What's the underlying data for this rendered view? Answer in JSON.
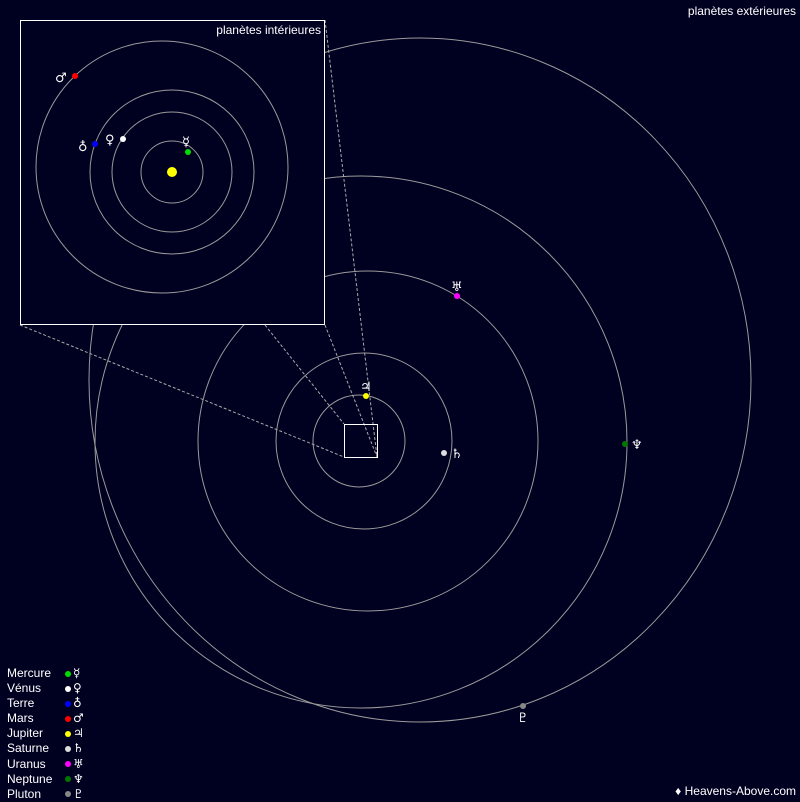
{
  "titles": {
    "outer": "planètes extérieures",
    "inner": "planètes intérieures"
  },
  "credit": "♦ Heavens-Above.com",
  "colors": {
    "background": "#000020",
    "orbit": "#9a9a9a",
    "sun": "#ffff00",
    "frame": "#ffffff"
  },
  "planets": [
    {
      "name": "Mercure",
      "symbol": "☿",
      "color": "#00dd00",
      "group": "inner"
    },
    {
      "name": "Vénus",
      "symbol": "♀",
      "color": "#ffffff",
      "group": "inner"
    },
    {
      "name": "Terre",
      "symbol": "♁",
      "color": "#0000ff",
      "group": "inner"
    },
    {
      "name": "Mars",
      "symbol": "♂",
      "color": "#ff0000",
      "group": "inner"
    },
    {
      "name": "Jupiter",
      "symbol": "♃",
      "color": "#ffff00",
      "group": "outer"
    },
    {
      "name": "Saturne",
      "symbol": "♄",
      "color": "#dddddd",
      "group": "outer"
    },
    {
      "name": "Uranus",
      "symbol": "♅",
      "color": "#ff00ff",
      "group": "outer"
    },
    {
      "name": "Neptune",
      "symbol": "♆",
      "color": "#007700",
      "group": "outer"
    },
    {
      "name": "Pluton",
      "symbol": "♇",
      "color": "#888888",
      "group": "outer"
    }
  ]
}
